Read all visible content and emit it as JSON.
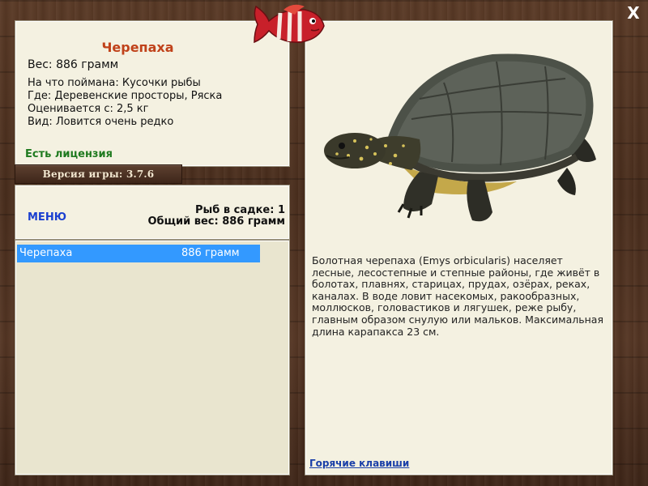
{
  "fish": {
    "name": "Черепаха",
    "weight_line": "Вес: 886 грамм",
    "bait_line": "На что поймана: Кусочки рыбы",
    "location_line": "Где: Деревенские просторы, Ряска",
    "value_line": "Оценивается с: 2,5 кг",
    "rarity_line": "Вид: Ловится очень редко",
    "license": "Есть лицензия",
    "description": "Болотная черепаха (Emys orbicularis) населяет лесные, лесостепные и степные районы, где живёт в болотах, плавнях, старицах, прудах, озёрах, реках, каналах. В воде ловит насекомых, ракообразных, моллюсков, головастиков и лягушек, реже рыбу, главным образом снулую или мальков. Максимальная длина карапакса 23 см."
  },
  "version": "Версия игры: 3.7.6",
  "menu_label": "МЕНЮ",
  "stats": {
    "count_line": "Рыб в садке: 1",
    "total_line": "Общий вес: 886 грамм"
  },
  "catch_list": [
    {
      "name": "Черепаха",
      "weight": "886 грамм"
    }
  ],
  "hotkeys_label": "Горячие клавиши",
  "close_label": "X",
  "colors": {
    "title": "#c0421a",
    "license": "#1f7a1f",
    "menu": "#1a3fd0",
    "selection": "#3399ff",
    "panel": "#f4f1e1"
  },
  "icons": [
    "fish-logo-icon",
    "close-icon",
    "turtle-image"
  ]
}
